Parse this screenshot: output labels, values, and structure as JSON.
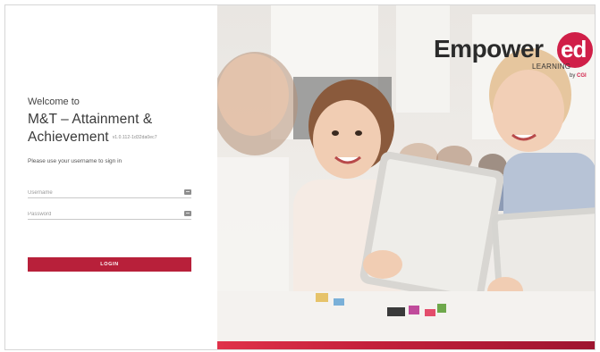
{
  "login": {
    "welcome": "Welcome to",
    "title_line1": "M&T – Attainment &",
    "title_line2": "Achievement",
    "version": "v1.0.112-1d32da0ec7",
    "instructions": "Please use your username to sign in",
    "username": {
      "value": "",
      "placeholder": "Username",
      "icon": "id-card-icon"
    },
    "password": {
      "value": "",
      "placeholder": "Password",
      "icon": "id-card-icon"
    },
    "login_button": "LOGIN",
    "button_color": "#b8203a"
  },
  "brand": {
    "empower": "Empower",
    "ed": "ed",
    "learning": "LEARNING",
    "by": "by",
    "cgi": "CGI",
    "accent_color": "#d01f48"
  }
}
